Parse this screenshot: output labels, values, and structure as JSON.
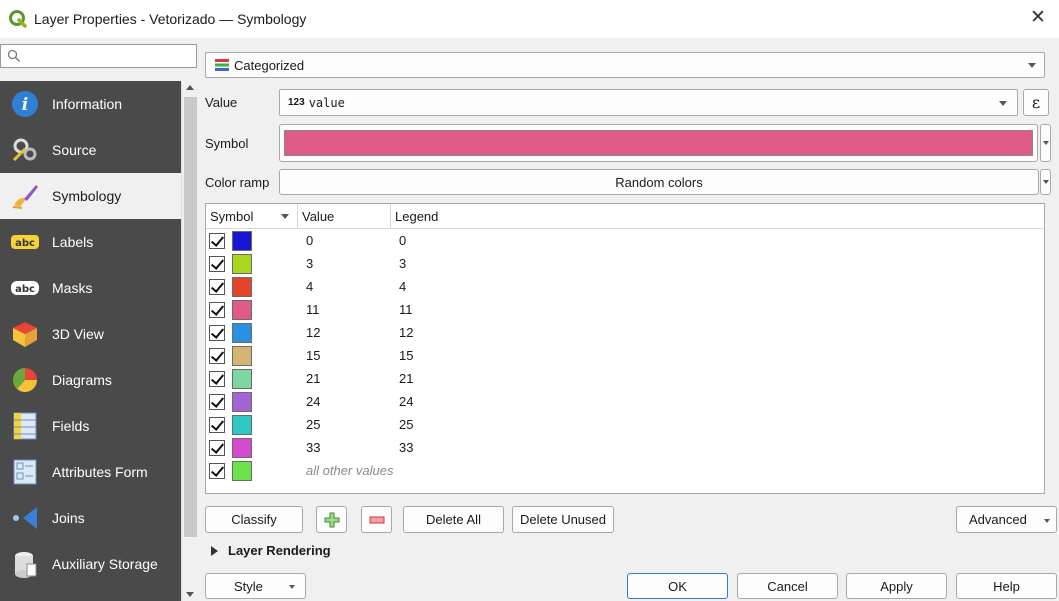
{
  "window": {
    "title": "Layer Properties - Vetorizado — Symbology"
  },
  "sidebar": {
    "items": [
      {
        "label": "Information",
        "icon": "information-icon"
      },
      {
        "label": "Source",
        "icon": "source-icon"
      },
      {
        "label": "Symbology",
        "icon": "symbology-brush-icon",
        "active": true
      },
      {
        "label": "Labels",
        "icon": "labels-abc-icon"
      },
      {
        "label": "Masks",
        "icon": "masks-abc-icon"
      },
      {
        "label": "3D View",
        "icon": "3d-cube-icon"
      },
      {
        "label": "Diagrams",
        "icon": "diagrams-icon"
      },
      {
        "label": "Fields",
        "icon": "fields-icon"
      },
      {
        "label": "Attributes Form",
        "icon": "attributes-form-icon"
      },
      {
        "label": "Joins",
        "icon": "joins-icon"
      },
      {
        "label": "Auxiliary Storage",
        "icon": "auxiliary-storage-icon"
      }
    ]
  },
  "renderer": {
    "type_label": "Categorized"
  },
  "form": {
    "value_label": "Value",
    "value_prefix": "123",
    "value_field": "value",
    "symbol_label": "Symbol",
    "symbol_color": "#e05a88",
    "color_ramp_label": "Color ramp",
    "color_ramp_value": "Random colors"
  },
  "table": {
    "headers": {
      "symbol": "Symbol",
      "value": "Value",
      "legend": "Legend"
    },
    "rows": [
      {
        "value": "0",
        "legend": "0",
        "color": "#1616d4"
      },
      {
        "value": "3",
        "legend": "3",
        "color": "#aad61e"
      },
      {
        "value": "4",
        "legend": "4",
        "color": "#e2452a"
      },
      {
        "value": "11",
        "legend": "11",
        "color": "#e05a88"
      },
      {
        "value": "12",
        "legend": "12",
        "color": "#2a91e2"
      },
      {
        "value": "15",
        "legend": "15",
        "color": "#d6b574"
      },
      {
        "value": "21",
        "legend": "21",
        "color": "#7ed6a0"
      },
      {
        "value": "24",
        "legend": "24",
        "color": "#a464d6"
      },
      {
        "value": "25",
        "legend": "25",
        "color": "#2ec9c2"
      },
      {
        "value": "33",
        "legend": "33",
        "color": "#d64ad0"
      },
      {
        "value": "all other values",
        "legend": "",
        "color": "#6ee24a",
        "italic": true
      }
    ]
  },
  "actions": {
    "classify": "Classify",
    "delete_all": "Delete All",
    "delete_unused": "Delete Unused",
    "advanced": "Advanced"
  },
  "layer_rendering": {
    "label": "Layer Rendering"
  },
  "footer": {
    "style": "Style",
    "ok": "OK",
    "cancel": "Cancel",
    "apply": "Apply",
    "help": "Help"
  }
}
